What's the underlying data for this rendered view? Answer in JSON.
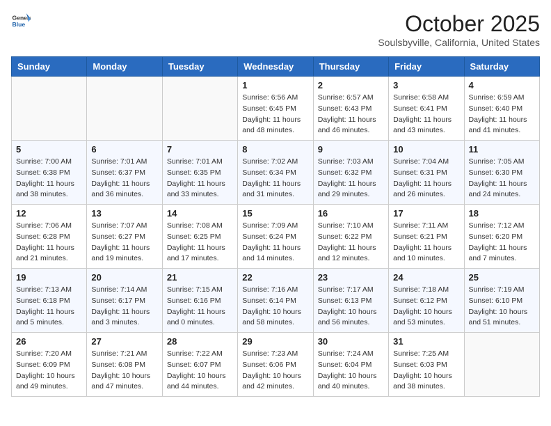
{
  "header": {
    "logo_line1": "General",
    "logo_line2": "Blue",
    "month": "October 2025",
    "location": "Soulsbyville, California, United States"
  },
  "weekdays": [
    "Sunday",
    "Monday",
    "Tuesday",
    "Wednesday",
    "Thursday",
    "Friday",
    "Saturday"
  ],
  "weeks": [
    [
      {
        "day": "",
        "info": ""
      },
      {
        "day": "",
        "info": ""
      },
      {
        "day": "",
        "info": ""
      },
      {
        "day": "1",
        "info": "Sunrise: 6:56 AM\nSunset: 6:45 PM\nDaylight: 11 hours\nand 48 minutes."
      },
      {
        "day": "2",
        "info": "Sunrise: 6:57 AM\nSunset: 6:43 PM\nDaylight: 11 hours\nand 46 minutes."
      },
      {
        "day": "3",
        "info": "Sunrise: 6:58 AM\nSunset: 6:41 PM\nDaylight: 11 hours\nand 43 minutes."
      },
      {
        "day": "4",
        "info": "Sunrise: 6:59 AM\nSunset: 6:40 PM\nDaylight: 11 hours\nand 41 minutes."
      }
    ],
    [
      {
        "day": "5",
        "info": "Sunrise: 7:00 AM\nSunset: 6:38 PM\nDaylight: 11 hours\nand 38 minutes."
      },
      {
        "day": "6",
        "info": "Sunrise: 7:01 AM\nSunset: 6:37 PM\nDaylight: 11 hours\nand 36 minutes."
      },
      {
        "day": "7",
        "info": "Sunrise: 7:01 AM\nSunset: 6:35 PM\nDaylight: 11 hours\nand 33 minutes."
      },
      {
        "day": "8",
        "info": "Sunrise: 7:02 AM\nSunset: 6:34 PM\nDaylight: 11 hours\nand 31 minutes."
      },
      {
        "day": "9",
        "info": "Sunrise: 7:03 AM\nSunset: 6:32 PM\nDaylight: 11 hours\nand 29 minutes."
      },
      {
        "day": "10",
        "info": "Sunrise: 7:04 AM\nSunset: 6:31 PM\nDaylight: 11 hours\nand 26 minutes."
      },
      {
        "day": "11",
        "info": "Sunrise: 7:05 AM\nSunset: 6:30 PM\nDaylight: 11 hours\nand 24 minutes."
      }
    ],
    [
      {
        "day": "12",
        "info": "Sunrise: 7:06 AM\nSunset: 6:28 PM\nDaylight: 11 hours\nand 21 minutes."
      },
      {
        "day": "13",
        "info": "Sunrise: 7:07 AM\nSunset: 6:27 PM\nDaylight: 11 hours\nand 19 minutes."
      },
      {
        "day": "14",
        "info": "Sunrise: 7:08 AM\nSunset: 6:25 PM\nDaylight: 11 hours\nand 17 minutes."
      },
      {
        "day": "15",
        "info": "Sunrise: 7:09 AM\nSunset: 6:24 PM\nDaylight: 11 hours\nand 14 minutes."
      },
      {
        "day": "16",
        "info": "Sunrise: 7:10 AM\nSunset: 6:22 PM\nDaylight: 11 hours\nand 12 minutes."
      },
      {
        "day": "17",
        "info": "Sunrise: 7:11 AM\nSunset: 6:21 PM\nDaylight: 11 hours\nand 10 minutes."
      },
      {
        "day": "18",
        "info": "Sunrise: 7:12 AM\nSunset: 6:20 PM\nDaylight: 11 hours\nand 7 minutes."
      }
    ],
    [
      {
        "day": "19",
        "info": "Sunrise: 7:13 AM\nSunset: 6:18 PM\nDaylight: 11 hours\nand 5 minutes."
      },
      {
        "day": "20",
        "info": "Sunrise: 7:14 AM\nSunset: 6:17 PM\nDaylight: 11 hours\nand 3 minutes."
      },
      {
        "day": "21",
        "info": "Sunrise: 7:15 AM\nSunset: 6:16 PM\nDaylight: 11 hours\nand 0 minutes."
      },
      {
        "day": "22",
        "info": "Sunrise: 7:16 AM\nSunset: 6:14 PM\nDaylight: 10 hours\nand 58 minutes."
      },
      {
        "day": "23",
        "info": "Sunrise: 7:17 AM\nSunset: 6:13 PM\nDaylight: 10 hours\nand 56 minutes."
      },
      {
        "day": "24",
        "info": "Sunrise: 7:18 AM\nSunset: 6:12 PM\nDaylight: 10 hours\nand 53 minutes."
      },
      {
        "day": "25",
        "info": "Sunrise: 7:19 AM\nSunset: 6:10 PM\nDaylight: 10 hours\nand 51 minutes."
      }
    ],
    [
      {
        "day": "26",
        "info": "Sunrise: 7:20 AM\nSunset: 6:09 PM\nDaylight: 10 hours\nand 49 minutes."
      },
      {
        "day": "27",
        "info": "Sunrise: 7:21 AM\nSunset: 6:08 PM\nDaylight: 10 hours\nand 47 minutes."
      },
      {
        "day": "28",
        "info": "Sunrise: 7:22 AM\nSunset: 6:07 PM\nDaylight: 10 hours\nand 44 minutes."
      },
      {
        "day": "29",
        "info": "Sunrise: 7:23 AM\nSunset: 6:06 PM\nDaylight: 10 hours\nand 42 minutes."
      },
      {
        "day": "30",
        "info": "Sunrise: 7:24 AM\nSunset: 6:04 PM\nDaylight: 10 hours\nand 40 minutes."
      },
      {
        "day": "31",
        "info": "Sunrise: 7:25 AM\nSunset: 6:03 PM\nDaylight: 10 hours\nand 38 minutes."
      },
      {
        "day": "",
        "info": ""
      }
    ]
  ]
}
